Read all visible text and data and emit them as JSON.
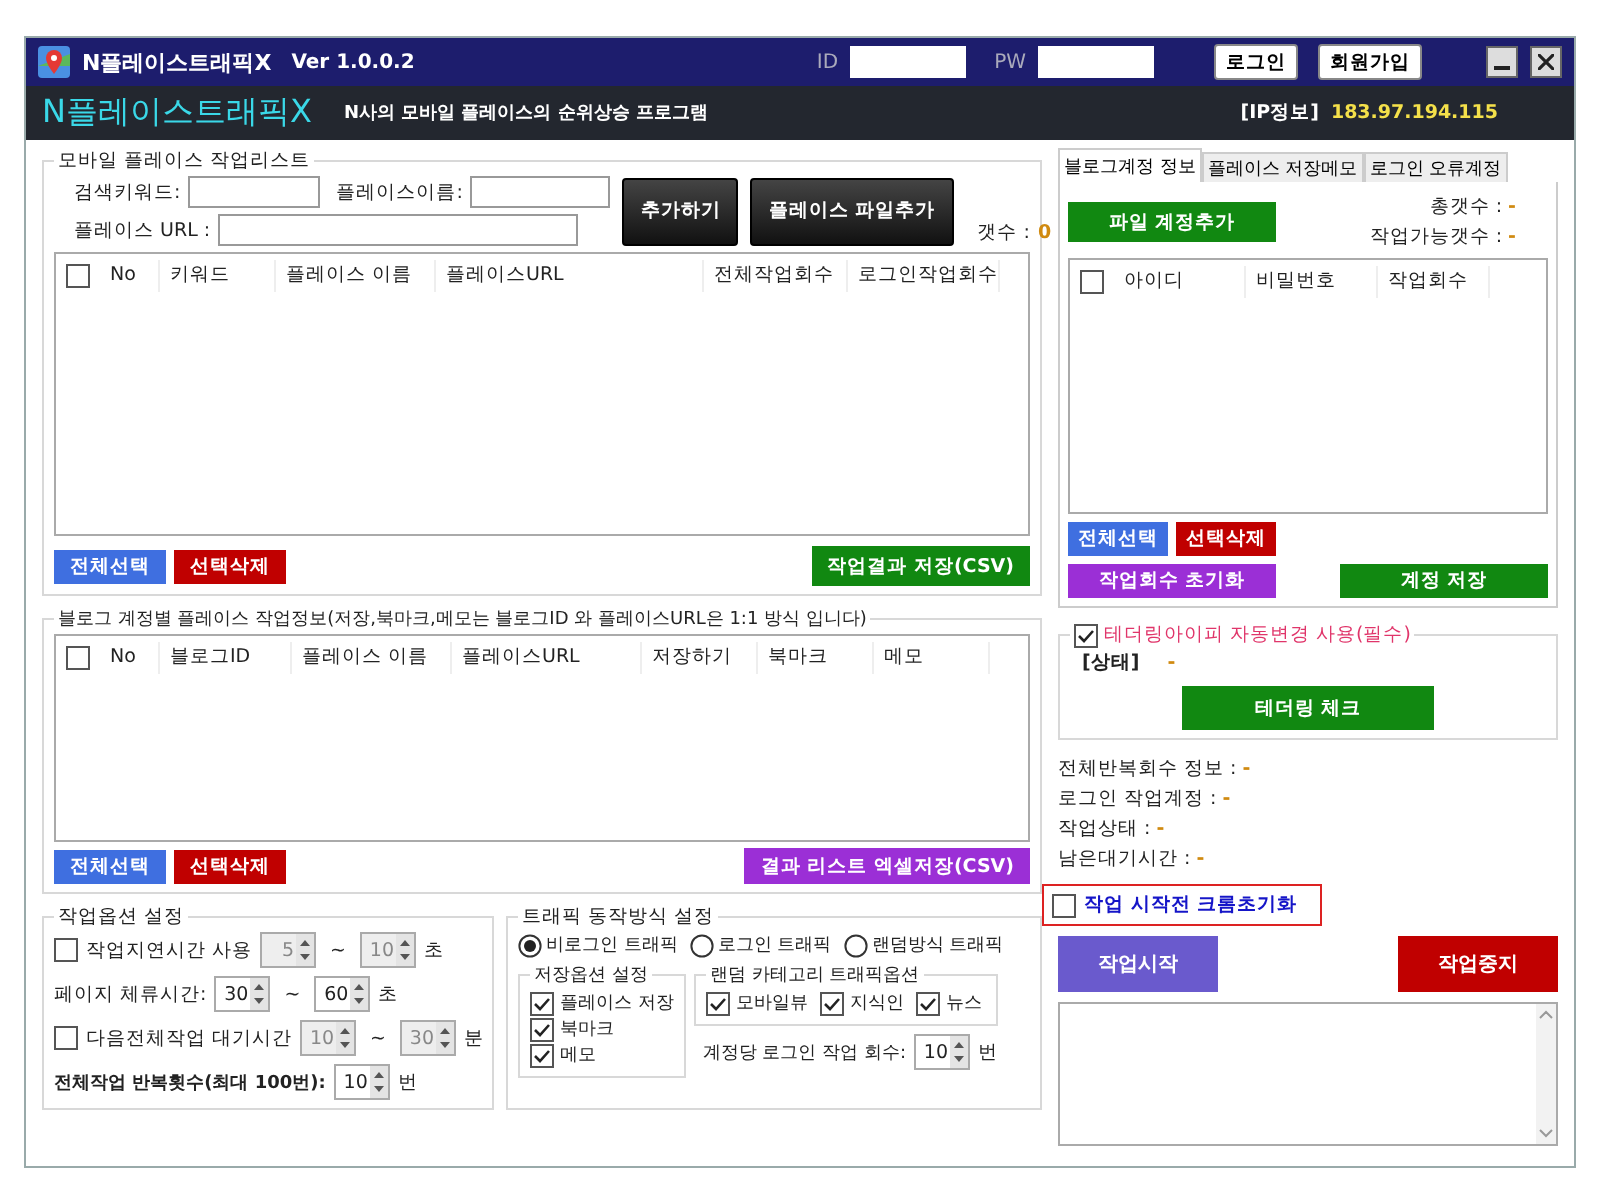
{
  "window": {
    "title": "N플레이스트래픽X",
    "version": "Ver 1.0.0.2",
    "id_label": "ID",
    "pw_label": "PW",
    "buttons": [
      "로그인",
      "회원가입"
    ]
  },
  "header": {
    "app_name": "N플레이스트래픽X",
    "tagline": "N사의 모바일 플레이스의 순위상승 프로그램",
    "ip_label": "[IP정보]",
    "ip": "183.97.194.115"
  },
  "place_list": {
    "title": "모바일 플레이스 작업리스트",
    "fields": [
      {
        "label": "검색키워드:"
      },
      {
        "label": "플레이스이름:"
      },
      {
        "label": "플레이스 URL :"
      }
    ],
    "add_buttons": [
      "추가하기",
      "플레이스 파일추가"
    ],
    "count_label": "갯수 :",
    "count": "0",
    "all_checked": false,
    "columns": [
      "No",
      "키워드",
      "플레이스 이름",
      "플레이스URL",
      "전체작업회수",
      "로그인작업회수"
    ],
    "buttons": [
      {
        "label": "전체선택",
        "color": "#3f6fe0"
      },
      {
        "label": "선택삭제",
        "color": "#c00000"
      }
    ],
    "save_button": {
      "label": "작업결과 저장(CSV)",
      "color": "#118811"
    }
  },
  "blog_list": {
    "title": "블로그 계정별 플레이스 작업정보(저장,북마크,메모는 블로그ID 와 플레이스URL은 1:1 방식 입니다)",
    "all_checked": false,
    "columns": [
      "No",
      "블로그ID",
      "플레이스 이름",
      "플레이스URL",
      "저장하기",
      "북마크",
      "메모"
    ],
    "buttons": [
      {
        "label": "전체선택",
        "color": "#3f6fe0"
      },
      {
        "label": "선택삭제",
        "color": "#c00000"
      }
    ],
    "save_button": {
      "label": "결과 리스트 엑셀저장(CSV)",
      "color": "#9b2fd6"
    }
  },
  "work_options": {
    "title": "작업옵션 설정",
    "rows": [
      {
        "kind": "checkbox",
        "label": "작업지연시간 사용",
        "checked": false,
        "spinners": [
          {
            "value": "5",
            "disabled": true
          },
          {
            "value": "10",
            "disabled": true
          }
        ],
        "separator": "~",
        "unit": "초"
      },
      {
        "kind": "label",
        "label": "페이지 체류시간:",
        "spinners": [
          {
            "value": "30",
            "disabled": false
          },
          {
            "value": "60",
            "disabled": false
          }
        ],
        "separator": "~",
        "unit": "초"
      },
      {
        "kind": "checkbox",
        "label": "다음전체작업 대기시간",
        "checked": false,
        "spinners": [
          {
            "value": "10",
            "disabled": true
          },
          {
            "value": "30",
            "disabled": true
          }
        ],
        "separator": "~",
        "unit": "분"
      },
      {
        "kind": "strong",
        "label": "전체작업 반복횟수(최대 100번):",
        "spinners": [
          {
            "value": "10",
            "disabled": false
          }
        ],
        "unit": "번"
      }
    ]
  },
  "traffic": {
    "title": "트래픽 동작방식 설정",
    "modes": [
      {
        "label": "비로그인 트래픽",
        "selected": true
      },
      {
        "label": "로그인 트래픽",
        "selected": false
      },
      {
        "label": "랜덤방식 트래픽",
        "selected": false
      }
    ],
    "save_options": {
      "title": "저장옵션 설정",
      "items": [
        {
          "label": "플레이스 저장",
          "checked": true
        },
        {
          "label": "북마크",
          "checked": true
        },
        {
          "label": "메모",
          "checked": true
        }
      ]
    },
    "random_options": {
      "title": "랜덤 카테고리 트래픽옵션",
      "items": [
        {
          "label": "모바일뷰",
          "checked": true
        },
        {
          "label": "지식인",
          "checked": true
        },
        {
          "label": "뉴스",
          "checked": true
        }
      ]
    },
    "login_count": {
      "label": "계정당 로그인 작업 회수:",
      "value": "10",
      "disabled": false,
      "unit": "번"
    }
  },
  "accounts": {
    "tabs": [
      {
        "label": "블로그계정 정보",
        "selected": true
      },
      {
        "label": "플레이스 저장메모",
        "selected": false
      },
      {
        "label": "로그인 오류계정",
        "selected": false
      }
    ],
    "file_button": {
      "label": "파일 계정추가",
      "color": "#118811"
    },
    "stats": [
      "총갯수 : **-**",
      "작업가능갯수 : **-**"
    ],
    "all_checked": false,
    "columns": [
      "아이디",
      "비밀번호",
      "작업회수"
    ],
    "buttons": [
      {
        "label": "전체선택",
        "color": "#3f6fe0"
      },
      {
        "label": "선택삭제",
        "color": "#c00000"
      }
    ],
    "bottom_buttons": [
      {
        "label": "작업회수 초기화",
        "color": "#9b2fd6"
      },
      {
        "label": "계정 저장",
        "color": "#118811"
      }
    ]
  },
  "tethering": {
    "label": "테더링아이피 자동변경 사용(필수)",
    "checked": true,
    "status_label": "[상태]",
    "status": "-",
    "button": "테더링 체크"
  },
  "info": [
    "전체반복회수 정보 : **-**",
    "로그인 작업계정 : **-**",
    "작업상태 : **-**",
    "남은대기시간 : **-**"
  ],
  "chrome_reset": {
    "label": "작업 시작전 크롬초기화",
    "checked": false,
    "highlighted": true
  },
  "controls": [
    {
      "label": "작업시작",
      "color": "#6a5acd"
    },
    {
      "label": "작업중지",
      "color": "#c00000"
    }
  ]
}
